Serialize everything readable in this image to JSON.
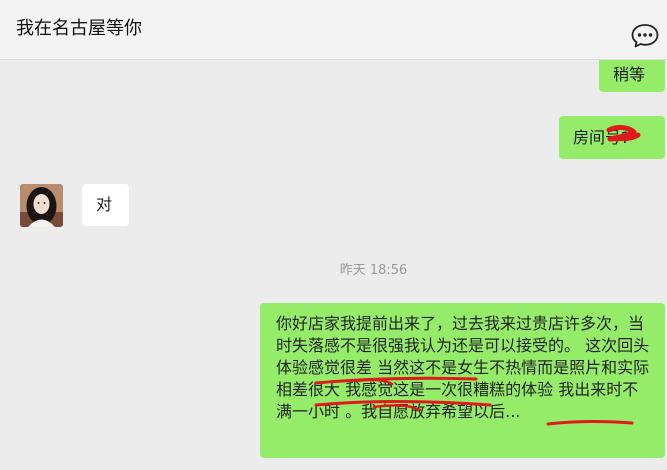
{
  "chat_title": "我在名古屋等你",
  "messages": {
    "m1": "稍等",
    "m2": "房间号?",
    "m3": "对",
    "time": "昨天 18:56",
    "m4": {
      "seg1": "你好店家我提前出来了，过去我来过贵店许多次，当时失落感不是很强我认为还是可以接受的。 ",
      "seg2": "这次回头体验感觉很差",
      "seg3": " 当然这不是女生不热情而是",
      "seg4": "照片和实际相差很大",
      "seg5": " 我感觉这是一次很糟糕的体验 我出来时不满一小时 。",
      "seg6": "我自愿放弃",
      "seg7": "希望以后..."
    }
  },
  "colors": {
    "my_bubble": "#95ec69",
    "their_bubble": "#ffffff",
    "background": "#ececec",
    "annotation": "#e01a1a"
  },
  "icons": {
    "more": "chat-bubble-ellipsis-icon",
    "avatar": "contact-avatar"
  }
}
